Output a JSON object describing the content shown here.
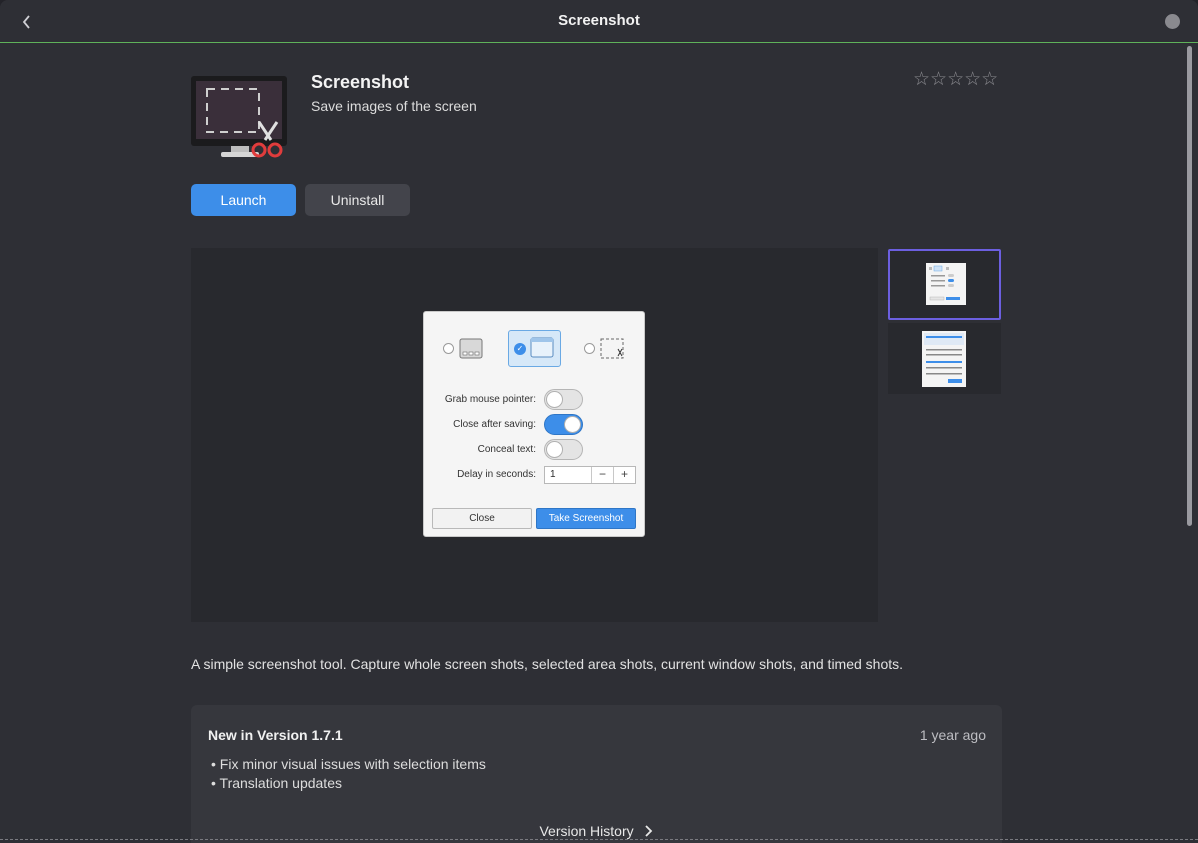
{
  "header": {
    "title": "Screenshot",
    "back_icon": "chevron-left-icon"
  },
  "app": {
    "name": "Screenshot",
    "summary": "Save images of the screen",
    "rating_stars": "☆☆☆☆☆",
    "rating_value": 0,
    "launch_label": "Launch",
    "uninstall_label": "Uninstall",
    "description": "A simple screenshot tool. Capture whole screen shots, selected area shots, current window shots, and timed shots."
  },
  "screenshot_preview": {
    "dialog": {
      "options": [
        {
          "label": "Grab mouse pointer:",
          "on": false
        },
        {
          "label": "Close after saving:",
          "on": true
        },
        {
          "label": "Conceal text:",
          "on": false
        }
      ],
      "delay_label": "Delay in seconds:",
      "delay_value": "1",
      "minus": "−",
      "plus": "+",
      "close_label": "Close",
      "take_label": "Take Screenshot"
    }
  },
  "release": {
    "title": "New in Version 1.7.1",
    "date": "1 year ago",
    "notes": [
      "• Fix minor visual issues with selection items",
      "• Translation updates"
    ],
    "history_label": "Version History",
    "history_icon": "chevron-right-icon"
  },
  "colors": {
    "accent": "#3d8ee9",
    "background": "#2e2f35",
    "selected_thumb_border": "#6c5fe0"
  }
}
